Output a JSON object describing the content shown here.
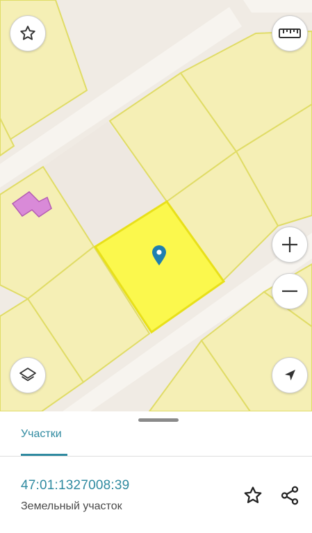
{
  "map": {
    "colors": {
      "background": "#f0ebe4",
      "road": "#f7f4ef",
      "parcel_fill": "#f5efb5",
      "parcel_border": "#e0dc66",
      "selected_fill": "#fbf84d",
      "selected_border": "#e8e01a",
      "building_fill": "#d98ad8",
      "building_border": "#b45db3",
      "pin": "#1f7fb0"
    },
    "controls": {
      "favorite_icon": "star-outline-icon",
      "ruler_icon": "ruler-icon",
      "zoom_in_icon": "plus-icon",
      "zoom_out_icon": "minus-icon",
      "layers_icon": "layers-icon",
      "locate_icon": "navigation-arrow-icon"
    }
  },
  "sheet": {
    "tab_label": "Участки",
    "parcel": {
      "cadastral_number": "47:01:1327008:39",
      "type": "Земельный участок"
    },
    "actions": {
      "favorite_icon": "star-outline-icon",
      "share_icon": "share-icon"
    },
    "colors": {
      "accent": "#2f8aa0"
    }
  }
}
